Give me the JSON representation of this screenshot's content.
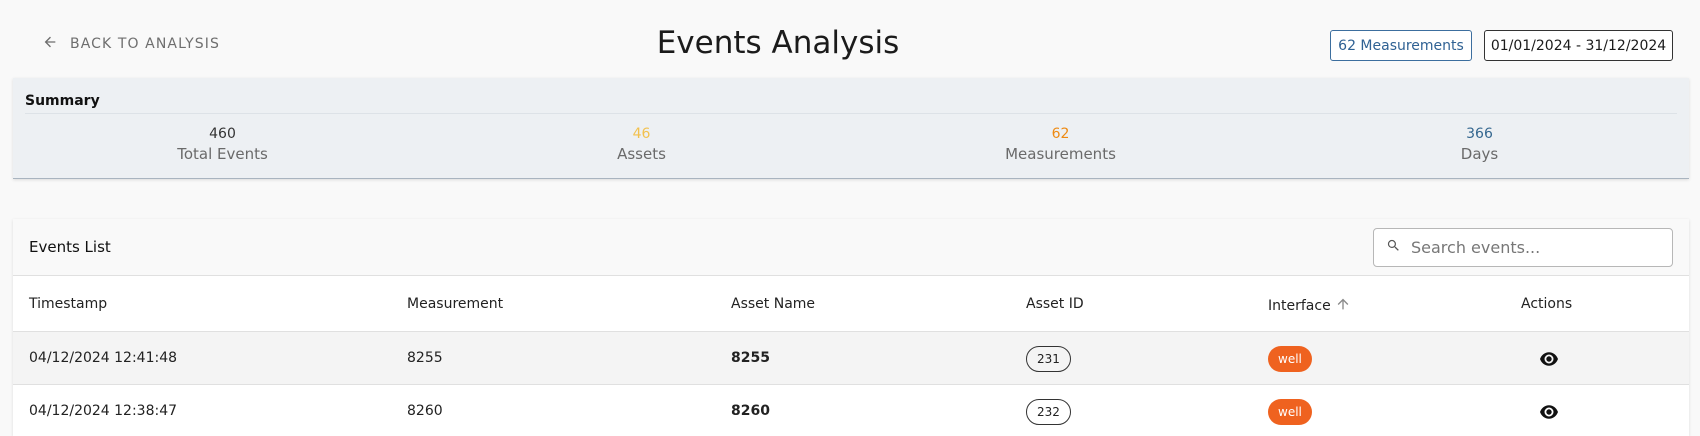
{
  "header": {
    "back_label": "BACK TO ANALYSIS",
    "title": "Events Analysis",
    "measurements_button": "62 Measurements",
    "date_range_button": "01/01/2024 - 31/12/2024"
  },
  "summary": {
    "title": "Summary",
    "stats": [
      {
        "value": "460",
        "label": "Total Events",
        "color": "#333333"
      },
      {
        "value": "46",
        "label": "Assets",
        "color": "#f2c14e"
      },
      {
        "value": "62",
        "label": "Measurements",
        "color": "#ee8a12"
      },
      {
        "value": "366",
        "label": "Days",
        "color": "#35678f"
      }
    ]
  },
  "events": {
    "title": "Events List",
    "search_placeholder": "Search events...",
    "columns": {
      "timestamp": "Timestamp",
      "measurement": "Measurement",
      "asset_name": "Asset Name",
      "asset_id": "Asset ID",
      "interface": "Interface",
      "actions": "Actions"
    },
    "sort_icon": "arrow-up-icon",
    "rows": [
      {
        "timestamp": "04/12/2024 12:41:48",
        "measurement": "8255",
        "asset_name": "8255",
        "asset_id": "231",
        "interface": "well"
      },
      {
        "timestamp": "04/12/2024 12:38:47",
        "measurement": "8260",
        "asset_name": "8260",
        "asset_id": "232",
        "interface": "well"
      }
    ]
  },
  "colors": {
    "accent": "#2f6193",
    "badge": "#ef621f"
  }
}
